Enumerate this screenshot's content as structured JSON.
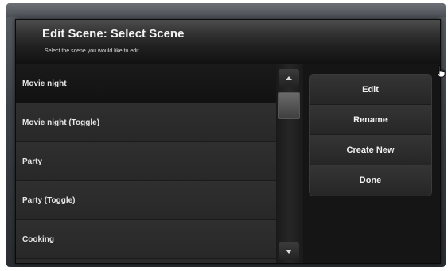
{
  "dialog": {
    "title": "Edit Scene: Select Scene",
    "subtitle": "Select the scene you would like to edit."
  },
  "scenes": [
    {
      "label": "Movie night",
      "selected": true
    },
    {
      "label": "Movie night (Toggle)",
      "selected": false
    },
    {
      "label": "Party",
      "selected": false
    },
    {
      "label": "Party (Toggle)",
      "selected": false
    },
    {
      "label": "Cooking",
      "selected": false
    }
  ],
  "actions": {
    "edit": "Edit",
    "rename": "Rename",
    "create_new": "Create New",
    "done": "Done"
  },
  "icons": {
    "scroll_up": "triangle-up-icon",
    "scroll_down": "triangle-down-icon",
    "cursor": "hand-pointer-icon"
  }
}
